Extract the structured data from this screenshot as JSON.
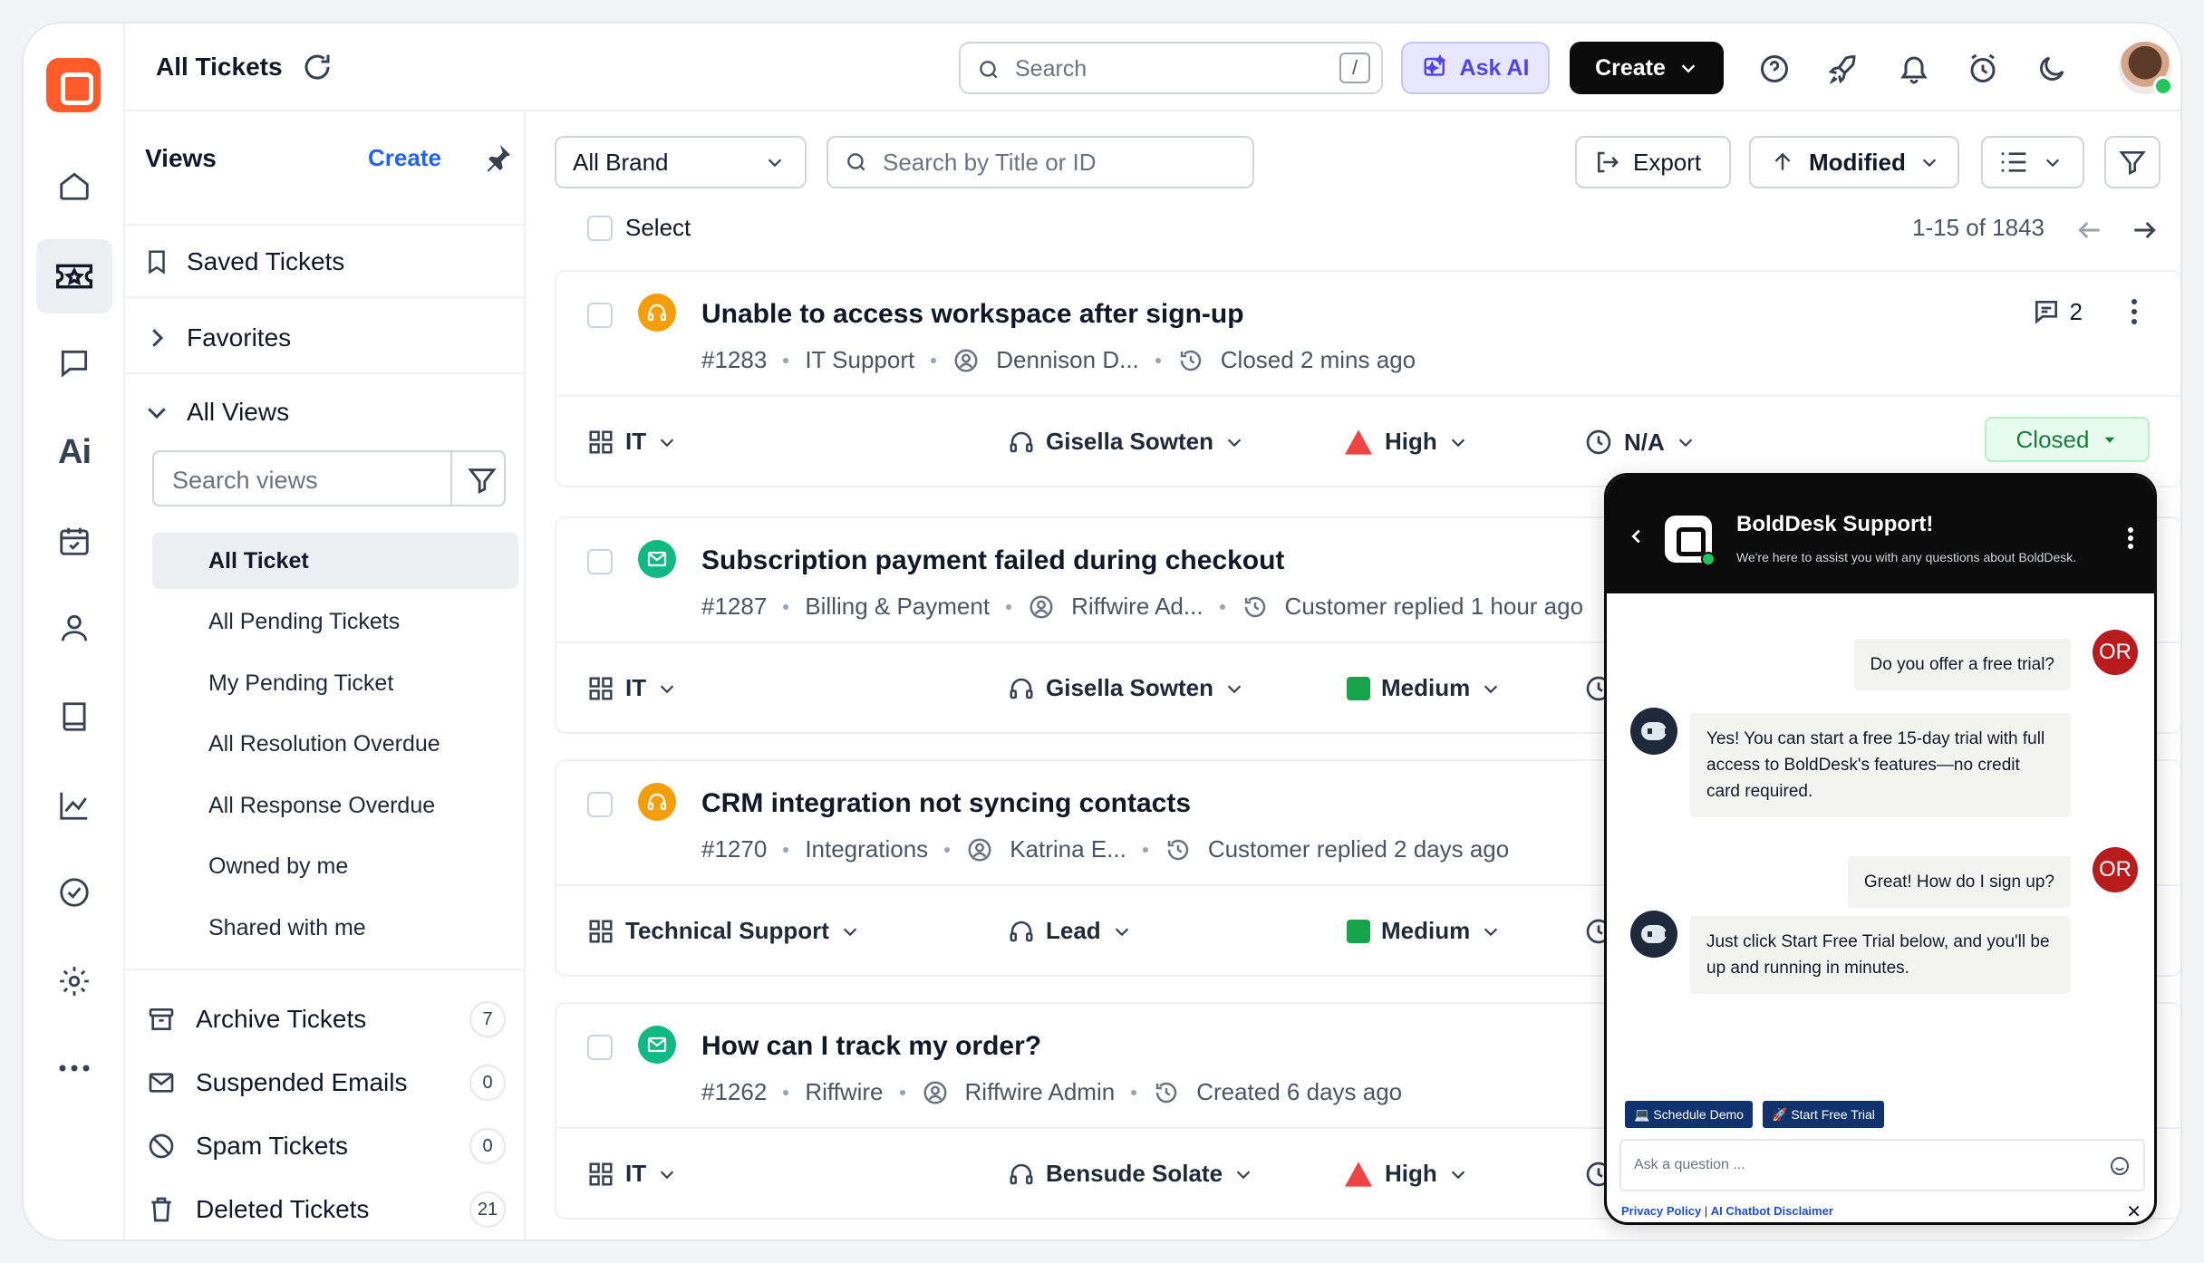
{
  "header": {
    "title": "All Tickets",
    "search_placeholder": "Search",
    "search_shortcut": "/",
    "ask_ai": "Ask AI",
    "create": "Create"
  },
  "views": {
    "heading": "Views",
    "create": "Create",
    "saved": "Saved Tickets",
    "favorites": "Favorites",
    "all_views": "All Views",
    "search_placeholder": "Search views",
    "items": [
      "All Ticket",
      "All Pending Tickets",
      "My Pending Ticket",
      "All Resolution Overdue",
      "All Response Overdue",
      "Owned by me",
      "Shared with me"
    ],
    "bottom": [
      {
        "label": "Archive Tickets",
        "count": "7"
      },
      {
        "label": "Suspended Emails",
        "count": "0"
      },
      {
        "label": "Spam Tickets",
        "count": "0"
      },
      {
        "label": "Deleted Tickets",
        "count": "21"
      }
    ]
  },
  "toolbar": {
    "brand": "All Brand",
    "search_placeholder": "Search by Title or ID",
    "export": "Export",
    "sort": "Modified",
    "select": "Select",
    "range": "1-15 of 1843"
  },
  "tickets": [
    {
      "title": "Unable to access workspace after sign-up",
      "id": "#1283",
      "category": "IT Support",
      "contact": "Dennison D...",
      "activity": "Closed 2 mins ago",
      "group": "IT",
      "agent": "Gisella Sowten",
      "priority": "High",
      "sla": "N/A",
      "status": "Closed",
      "comments": "2",
      "icon_color": "#f59e0b"
    },
    {
      "title": "Subscription payment failed during checkout",
      "id": "#1287",
      "category": "Billing & Payment",
      "contact": "Riffwire Ad...",
      "activity": "Customer replied 1 hour ago",
      "group": "IT",
      "agent": "Gisella Sowten",
      "priority": "Medium",
      "icon_color": "#10b981"
    },
    {
      "title": "CRM integration not syncing contacts",
      "id": "#1270",
      "category": "Integrations",
      "contact": "Katrina E...",
      "activity": "Customer replied 2 days ago",
      "group": "Technical Support",
      "agent": "Lead",
      "priority": "Medium",
      "icon_color": "#f59e0b"
    },
    {
      "title": "How can I track my order?",
      "id": "#1262",
      "category": "Riffwire",
      "contact": "Riffwire Admin",
      "activity": "Created 6 days ago",
      "group": "IT",
      "agent": "Bensude Solate",
      "priority": "High",
      "icon_color": "#10b981"
    }
  ],
  "chat": {
    "title": "BoldDesk Support!",
    "subtitle": "We're here to assist you with any questions about BoldDesk.",
    "user_initials": "OR",
    "messages": [
      "Do you offer a free trial?",
      "Yes! You can start a free 15-day trial with full access to BoldDesk's features—no credit card required.",
      "Great! How do I sign up?",
      "Just click Start Free Trial below, and you'll be up and running in minutes."
    ],
    "chip_demo": "Schedule Demo",
    "chip_trial": "Start Free Trial",
    "input_placeholder": "Ask a question ...",
    "privacy": "Privacy Policy",
    "disclaimer": "AI Chatbot Disclaimer"
  },
  "colors": {
    "accent": "#2563eb",
    "brand": "#ff5b29",
    "high": "#ef4444",
    "medium": "#16a34a",
    "closed": "#15803d"
  }
}
